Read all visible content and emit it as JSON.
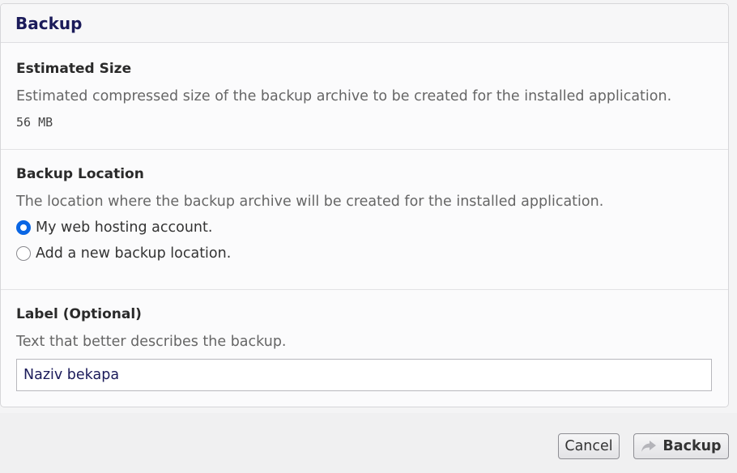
{
  "panel": {
    "title": "Backup"
  },
  "estimated_size": {
    "heading": "Estimated Size",
    "description": "Estimated compressed size of the backup archive to be created for the installed application.",
    "value": "56 MB"
  },
  "backup_location": {
    "heading": "Backup Location",
    "description": "The location where the backup archive will be created for the installed application.",
    "options": [
      {
        "label": "My web hosting account.",
        "checked": true
      },
      {
        "label": "Add a new backup location.",
        "checked": false
      }
    ]
  },
  "label_field": {
    "heading": "Label (Optional)",
    "description": "Text that better describes the backup.",
    "value": "Naziv bekapa"
  },
  "footer": {
    "cancel_label": "Cancel",
    "backup_label": "Backup",
    "backup_icon": "share-arrow-icon"
  },
  "colors": {
    "title": "#1b1b5a",
    "radio_checked": "#0a66e4"
  }
}
